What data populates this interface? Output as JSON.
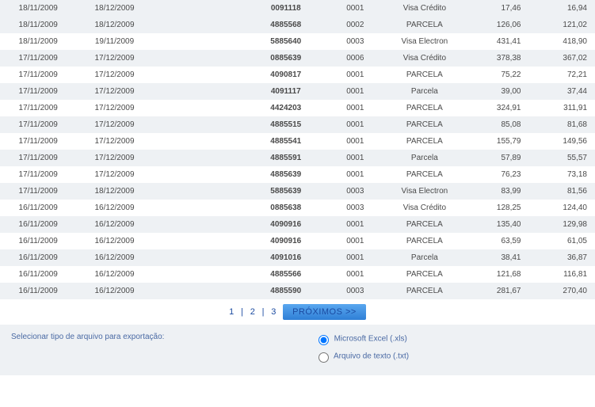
{
  "rows": [
    {
      "shade": true,
      "d1": "18/11/2009",
      "d2": "18/12/2009",
      "doc": "0091118",
      "seq": "0001",
      "type": "Visa Crédito",
      "v1": "17,46",
      "v2": "16,94"
    },
    {
      "shade": true,
      "d1": "18/11/2009",
      "d2": "18/12/2009",
      "doc": "4885568",
      "seq": "0002",
      "type": "PARCELA",
      "v1": "126,06",
      "v2": "121,02"
    },
    {
      "shade": false,
      "d1": "18/11/2009",
      "d2": "19/11/2009",
      "doc": "5885640",
      "seq": "0003",
      "type": "Visa Electron",
      "v1": "431,41",
      "v2": "418,90"
    },
    {
      "shade": true,
      "d1": "17/11/2009",
      "d2": "17/12/2009",
      "doc": "0885639",
      "seq": "0006",
      "type": "Visa Crédito",
      "v1": "378,38",
      "v2": "367,02"
    },
    {
      "shade": false,
      "d1": "17/11/2009",
      "d2": "17/12/2009",
      "doc": "4090817",
      "seq": "0001",
      "type": "PARCELA",
      "v1": "75,22",
      "v2": "72,21"
    },
    {
      "shade": true,
      "d1": "17/11/2009",
      "d2": "17/12/2009",
      "doc": "4091117",
      "seq": "0001",
      "type": "Parcela",
      "v1": "39,00",
      "v2": "37,44"
    },
    {
      "shade": false,
      "d1": "17/11/2009",
      "d2": "17/12/2009",
      "doc": "4424203",
      "seq": "0001",
      "type": "PARCELA",
      "v1": "324,91",
      "v2": "311,91"
    },
    {
      "shade": true,
      "d1": "17/11/2009",
      "d2": "17/12/2009",
      "doc": "4885515",
      "seq": "0001",
      "type": "PARCELA",
      "v1": "85,08",
      "v2": "81,68"
    },
    {
      "shade": false,
      "d1": "17/11/2009",
      "d2": "17/12/2009",
      "doc": "4885541",
      "seq": "0001",
      "type": "PARCELA",
      "v1": "155,79",
      "v2": "149,56"
    },
    {
      "shade": true,
      "d1": "17/11/2009",
      "d2": "17/12/2009",
      "doc": "4885591",
      "seq": "0001",
      "type": "Parcela",
      "v1": "57,89",
      "v2": "55,57"
    },
    {
      "shade": false,
      "d1": "17/11/2009",
      "d2": "17/12/2009",
      "doc": "4885639",
      "seq": "0001",
      "type": "PARCELA",
      "v1": "76,23",
      "v2": "73,18"
    },
    {
      "shade": true,
      "d1": "17/11/2009",
      "d2": "18/12/2009",
      "doc": "5885639",
      "seq": "0003",
      "type": "Visa Electron",
      "v1": "83,99",
      "v2": "81,56"
    },
    {
      "shade": false,
      "d1": "16/11/2009",
      "d2": "16/12/2009",
      "doc": "0885638",
      "seq": "0003",
      "type": "Visa Crédito",
      "v1": "128,25",
      "v2": "124,40"
    },
    {
      "shade": true,
      "d1": "16/11/2009",
      "d2": "16/12/2009",
      "doc": "4090916",
      "seq": "0001",
      "type": "PARCELA",
      "v1": "135,40",
      "v2": "129,98"
    },
    {
      "shade": false,
      "d1": "16/11/2009",
      "d2": "16/12/2009",
      "doc": "4090916",
      "seq": "0001",
      "type": "PARCELA",
      "v1": "63,59",
      "v2": "61,05"
    },
    {
      "shade": true,
      "d1": "16/11/2009",
      "d2": "16/12/2009",
      "doc": "4091016",
      "seq": "0001",
      "type": "Parcela",
      "v1": "38,41",
      "v2": "36,87"
    },
    {
      "shade": false,
      "d1": "16/11/2009",
      "d2": "16/12/2009",
      "doc": "4885566",
      "seq": "0001",
      "type": "PARCELA",
      "v1": "121,68",
      "v2": "116,81"
    },
    {
      "shade": true,
      "d1": "16/11/2009",
      "d2": "16/12/2009",
      "doc": "4885590",
      "seq": "0003",
      "type": "PARCELA",
      "v1": "281,67",
      "v2": "270,40"
    }
  ],
  "pager": {
    "p1": "1",
    "p2": "2",
    "p3": "3",
    "next": "PRÓXIMOS >>"
  },
  "export": {
    "label": "Selecionar tipo de arquivo para exportação:",
    "opt1": "Microsoft Excel (.xls)",
    "opt2": "Arquivo de texto (.txt)"
  }
}
